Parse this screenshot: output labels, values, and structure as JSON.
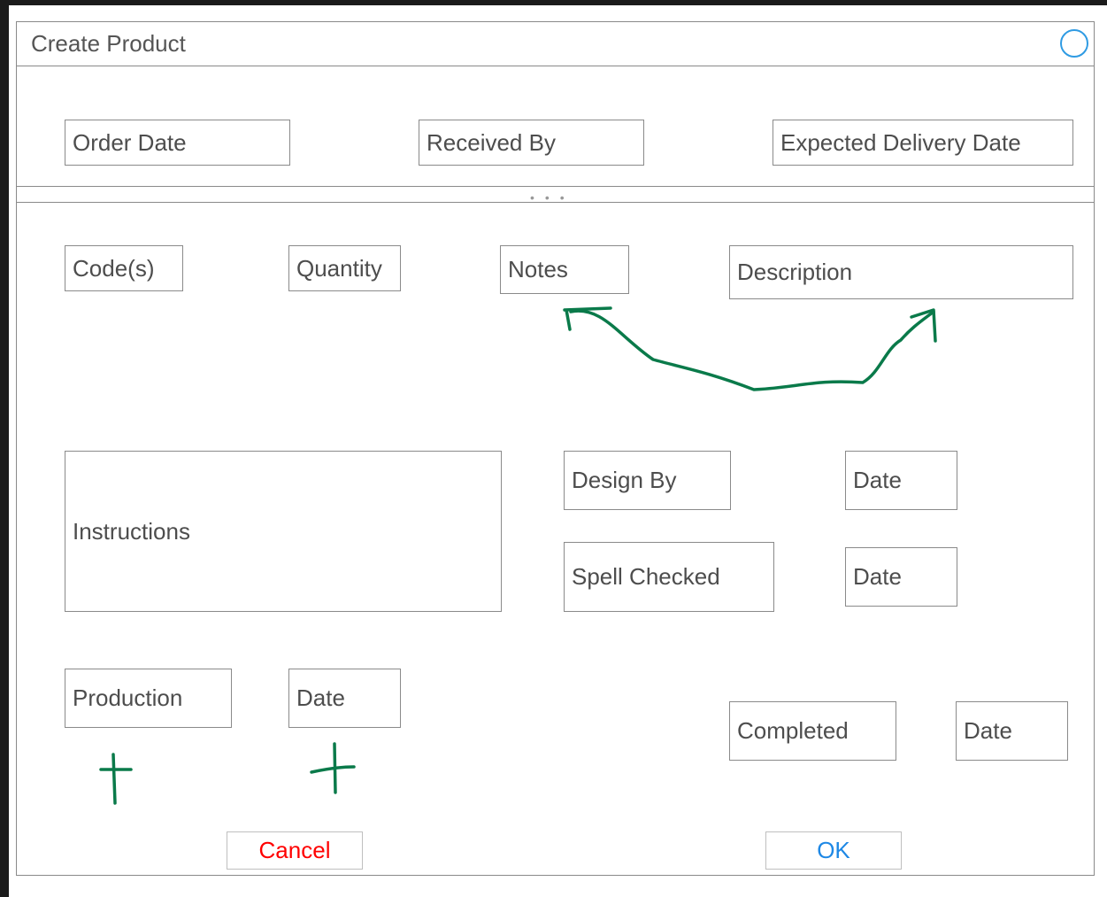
{
  "window": {
    "title": "Create Product"
  },
  "header_fields": {
    "order_date": "Order Date",
    "received_by": "Received By",
    "expected_delivery_date": "Expected Delivery Date"
  },
  "fields": {
    "codes": "Code(s)",
    "quantity": "Quantity",
    "notes": "Notes",
    "description": "Description",
    "instructions": "Instructions",
    "design_by": "Design By",
    "design_date": "Date",
    "spell_checked": "Spell Checked",
    "spell_checked_date": "Date",
    "production": "Production",
    "production_date": "Date",
    "completed": "Completed",
    "completed_date": "Date"
  },
  "buttons": {
    "cancel": "Cancel",
    "ok": "OK"
  },
  "colors": {
    "cancel_text": "#ff0000",
    "ok_text": "#1e88e5",
    "close_circle": "#2f9be3",
    "annotation_ink": "#0a7a4a"
  }
}
